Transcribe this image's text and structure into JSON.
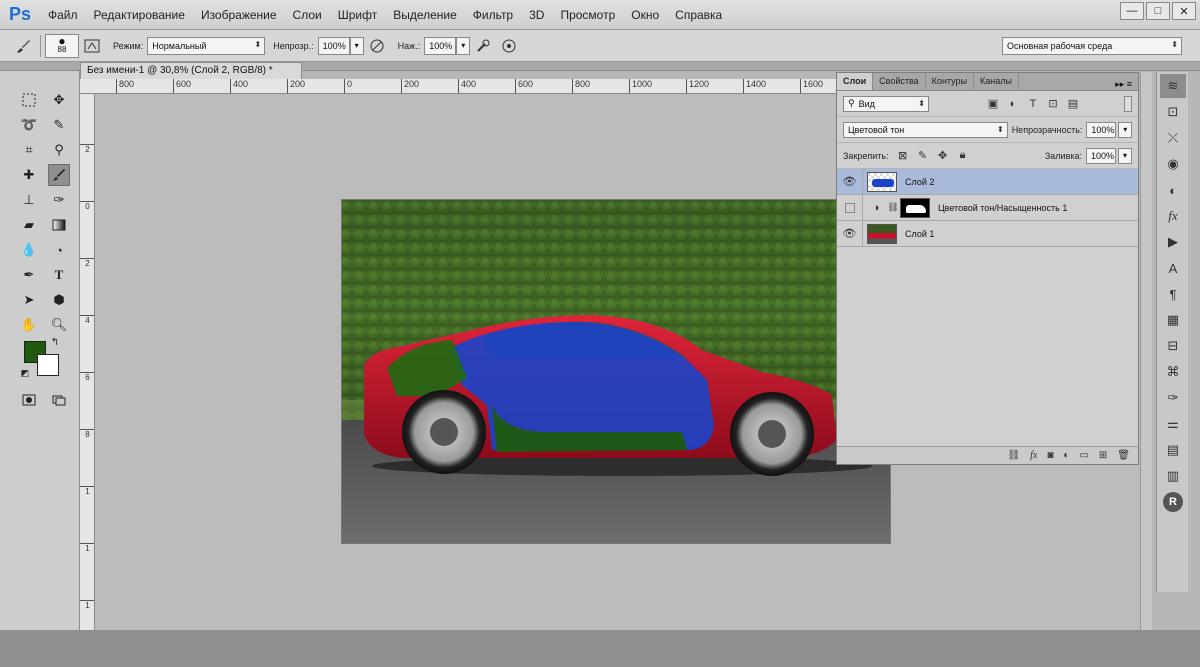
{
  "app": {
    "logo": "Ps"
  },
  "menu": [
    "Файл",
    "Редактирование",
    "Изображение",
    "Слои",
    "Шрифт",
    "Выделение",
    "Фильтр",
    "3D",
    "Просмотр",
    "Окно",
    "Справка"
  ],
  "window_controls": [
    "—",
    "□",
    "✕"
  ],
  "options": {
    "brush_size": "88",
    "mode_label": "Режим:",
    "mode_value": "Нормальный",
    "opacity_label": "Непрозр.:",
    "opacity_value": "100%",
    "flow_label": "Наж.:",
    "flow_value": "100%",
    "workspace": "Основная рабочая среда"
  },
  "document": {
    "tab_title": "Без имени-1 @ 30,8% (Слой 2, RGB/8) *",
    "ruler_h": [
      "800",
      "600",
      "400",
      "200",
      "0",
      "200",
      "400",
      "600",
      "800",
      "1000",
      "1200",
      "1400",
      "1600"
    ],
    "ruler_v": [
      "2",
      "0",
      "2",
      "4",
      "6",
      "8",
      "1",
      "1",
      "1",
      "1"
    ]
  },
  "layers_panel": {
    "tabs": [
      "Слои",
      "Свойства",
      "Контуры",
      "Каналы"
    ],
    "filter_kind": "Вид",
    "blend_mode": "Цветовой тон",
    "opacity_label": "Непрозрачность:",
    "opacity_value": "100%",
    "lock_label": "Закрепить:",
    "fill_label": "Заливка:",
    "fill_value": "100%",
    "layers": [
      {
        "name": "Слой 2",
        "visible": true,
        "selected": true
      },
      {
        "name": "Цветовой тон/Насыщенность 1",
        "visible": false,
        "selected": false
      },
      {
        "name": "Слой 1",
        "visible": true,
        "selected": false
      }
    ]
  },
  "colors": {
    "foreground": "#1f5a0e",
    "background": "#ffffff",
    "selection": "#aabadb",
    "car_paint": "#c8102e"
  }
}
